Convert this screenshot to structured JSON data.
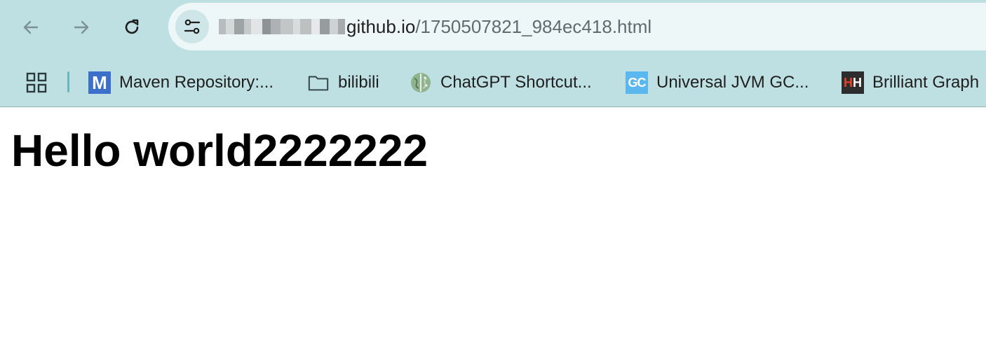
{
  "browser": {
    "url_host": "github.io",
    "url_path": "/1750507821_984ec418.html",
    "back_icon": "arrow-left-icon",
    "forward_icon": "arrow-right-icon",
    "reload_icon": "reload-icon",
    "site_info_icon": "tune-icon"
  },
  "bookmarks": {
    "items": [
      {
        "label": "Maven Repository:...",
        "icon": "maven-icon"
      },
      {
        "label": "bilibili",
        "icon": "folder-icon"
      },
      {
        "label": "ChatGPT Shortcut...",
        "icon": "brain-icon"
      },
      {
        "label": "Universal JVM GC...",
        "icon": "gc-icon"
      },
      {
        "label": "Brilliant Graph",
        "icon": "hh-icon"
      }
    ],
    "maven_glyph": "M",
    "gc_glyph": "GC",
    "hh_glyph_1": "H",
    "hh_glyph_2": "H"
  },
  "page": {
    "heading": "Hello world2222222"
  },
  "colors": {
    "chrome_bg": "#bfe0e3",
    "omnibox_bg": "#eef7f8",
    "page_bg": "#ffffff"
  }
}
